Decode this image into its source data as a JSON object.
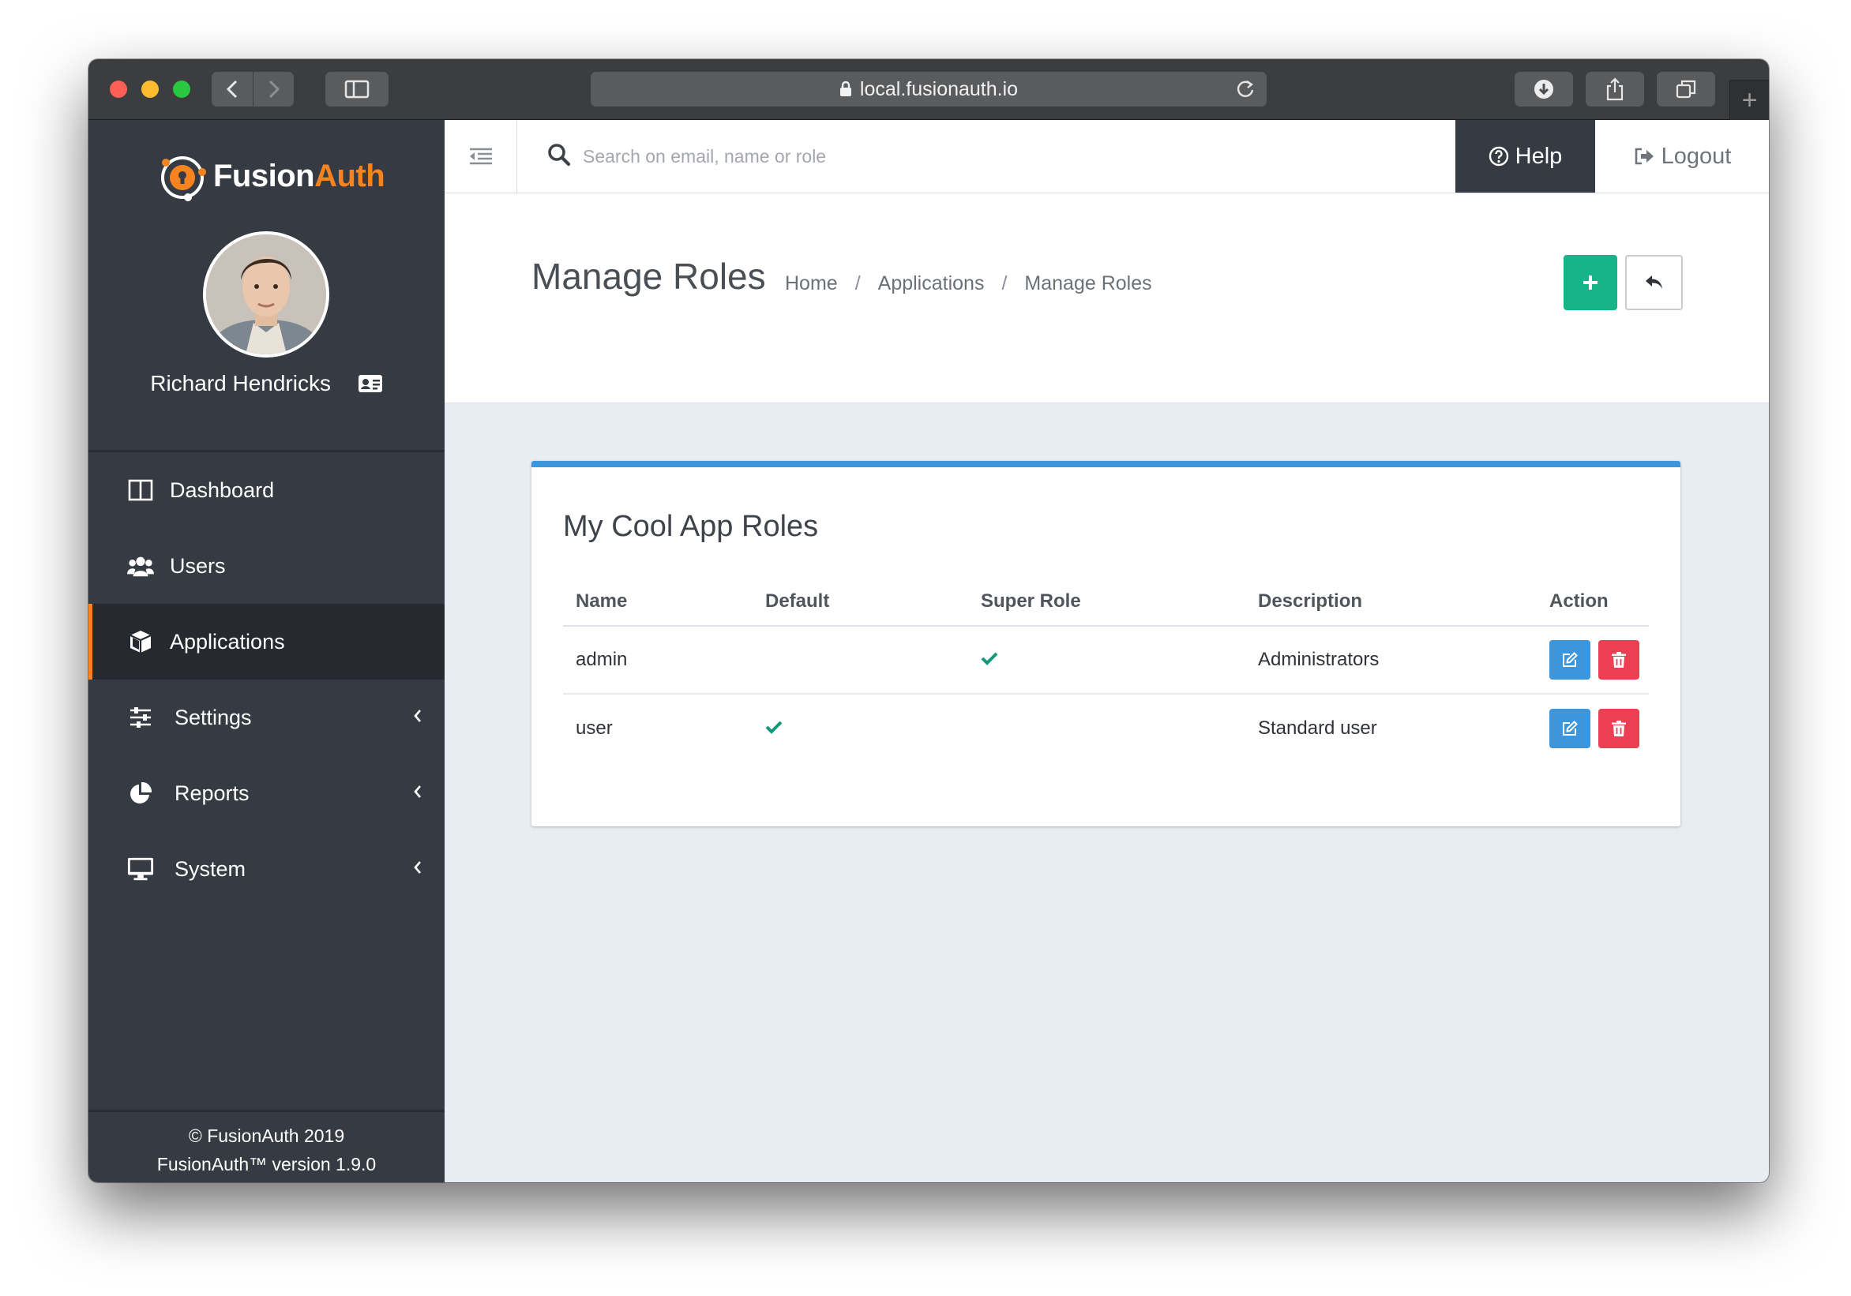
{
  "browser": {
    "url": "local.fusionauth.io",
    "new_tab": "+"
  },
  "brand": {
    "name_part1": "Fusion",
    "name_part2": "Auth",
    "accent": "#f58320"
  },
  "user": {
    "name": "Richard Hendricks"
  },
  "sidebar": {
    "items": [
      {
        "label": "Dashboard",
        "icon": "columns-icon",
        "active": false,
        "has_children": false
      },
      {
        "label": "Users",
        "icon": "users-icon",
        "active": false,
        "has_children": false
      },
      {
        "label": "Applications",
        "icon": "cube-icon",
        "active": true,
        "has_children": false
      },
      {
        "label": "Settings",
        "icon": "sliders-icon",
        "active": false,
        "has_children": true
      },
      {
        "label": "Reports",
        "icon": "pie-chart-icon",
        "active": false,
        "has_children": true
      },
      {
        "label": "System",
        "icon": "desktop-icon",
        "active": false,
        "has_children": true
      }
    ],
    "footer_copyright": "© FusionAuth 2019",
    "footer_version": "FusionAuth™ version 1.9.0"
  },
  "header": {
    "search_placeholder": "Search on email, name or role",
    "help_label": "Help",
    "logout_label": "Logout"
  },
  "page": {
    "title": "Manage Roles",
    "breadcrumb": [
      "Home",
      "Applications",
      "Manage Roles"
    ],
    "breadcrumb_separator": "/"
  },
  "panel": {
    "title": "My Cool App Roles",
    "columns": [
      "Name",
      "Default",
      "Super Role",
      "Description",
      "Action"
    ],
    "rows": [
      {
        "name": "admin",
        "default": false,
        "super_role": true,
        "description": "Administrators"
      },
      {
        "name": "user",
        "default": true,
        "super_role": false,
        "description": "Standard user"
      }
    ]
  },
  "colors": {
    "sidebar_bg": "#363b43",
    "add_button": "#17b48a",
    "edit_button": "#3c96dd",
    "delete_button": "#ec3f52",
    "panel_accent": "#3c96dd",
    "check": "#14987a"
  }
}
